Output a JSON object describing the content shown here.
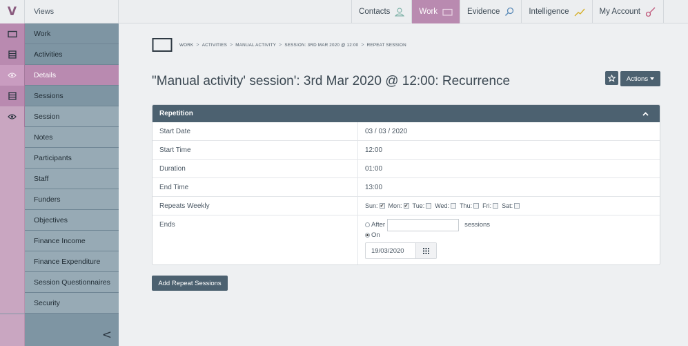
{
  "app": {
    "logo": "V",
    "views_label": "Views"
  },
  "topnav": [
    {
      "label": "Contacts",
      "icon": "person-icon",
      "active": false
    },
    {
      "label": "Work",
      "icon": "folder-icon",
      "active": true
    },
    {
      "label": "Evidence",
      "icon": "magnifier-icon",
      "active": false
    },
    {
      "label": "Intelligence",
      "icon": "trend-icon",
      "active": false
    },
    {
      "label": "My Account",
      "icon": "key-icon",
      "active": false
    }
  ],
  "sidebar": {
    "items": [
      {
        "label": "Work",
        "icon": "folder-icon"
      },
      {
        "label": "Activities",
        "icon": "list-icon"
      },
      {
        "label": "Details",
        "icon": "eye-icon"
      },
      {
        "label": "Sessions",
        "icon": "list-icon"
      },
      {
        "label": "Session",
        "icon": "eye-icon"
      },
      {
        "label": "Notes"
      },
      {
        "label": "Participants"
      },
      {
        "label": "Staff"
      },
      {
        "label": "Funders"
      },
      {
        "label": "Objectives"
      },
      {
        "label": "Finance Income"
      },
      {
        "label": "Finance Expenditure"
      },
      {
        "label": "Session Questionnaires"
      },
      {
        "label": "Security"
      }
    ],
    "collapse_glyph": "<"
  },
  "breadcrumb": [
    "WORK",
    "ACTIVITIES",
    "MANUAL ACTIVITY",
    "SESSION: 3RD MAR 2020 @ 12:00",
    "REPEAT SESSION"
  ],
  "breadcrumb_sep": ">",
  "page_title": "\"Manual activity' session': 3rd Mar 2020 @ 12:00: Recurrence",
  "actions_label": "Actions",
  "panel": {
    "title": "Repetition",
    "rows": [
      {
        "label": "Start Date",
        "value": "03 / 03 / 2020"
      },
      {
        "label": "Start Time",
        "value": "12:00"
      },
      {
        "label": "Duration",
        "value": "01:00"
      },
      {
        "label": "End Time",
        "value": "13:00"
      }
    ],
    "repeats_label": "Repeats Weekly",
    "days": [
      {
        "label": "Sun:",
        "checked": true
      },
      {
        "label": "Mon:",
        "checked": true
      },
      {
        "label": "Tue:",
        "checked": false
      },
      {
        "label": "Wed:",
        "checked": false
      },
      {
        "label": "Thu:",
        "checked": false
      },
      {
        "label": "Fri:",
        "checked": false
      },
      {
        "label": "Sat:",
        "checked": false
      }
    ],
    "ends_label": "Ends",
    "after_label": "After",
    "after_value": "",
    "sessions_label": "sessions",
    "on_label": "On",
    "on_date": "19/03/2020"
  },
  "add_button_label": "Add Repeat Sessions",
  "colors": {
    "accent": "#b98ab0",
    "dark": "#4c6170",
    "sidebar": "#7e95a3"
  }
}
